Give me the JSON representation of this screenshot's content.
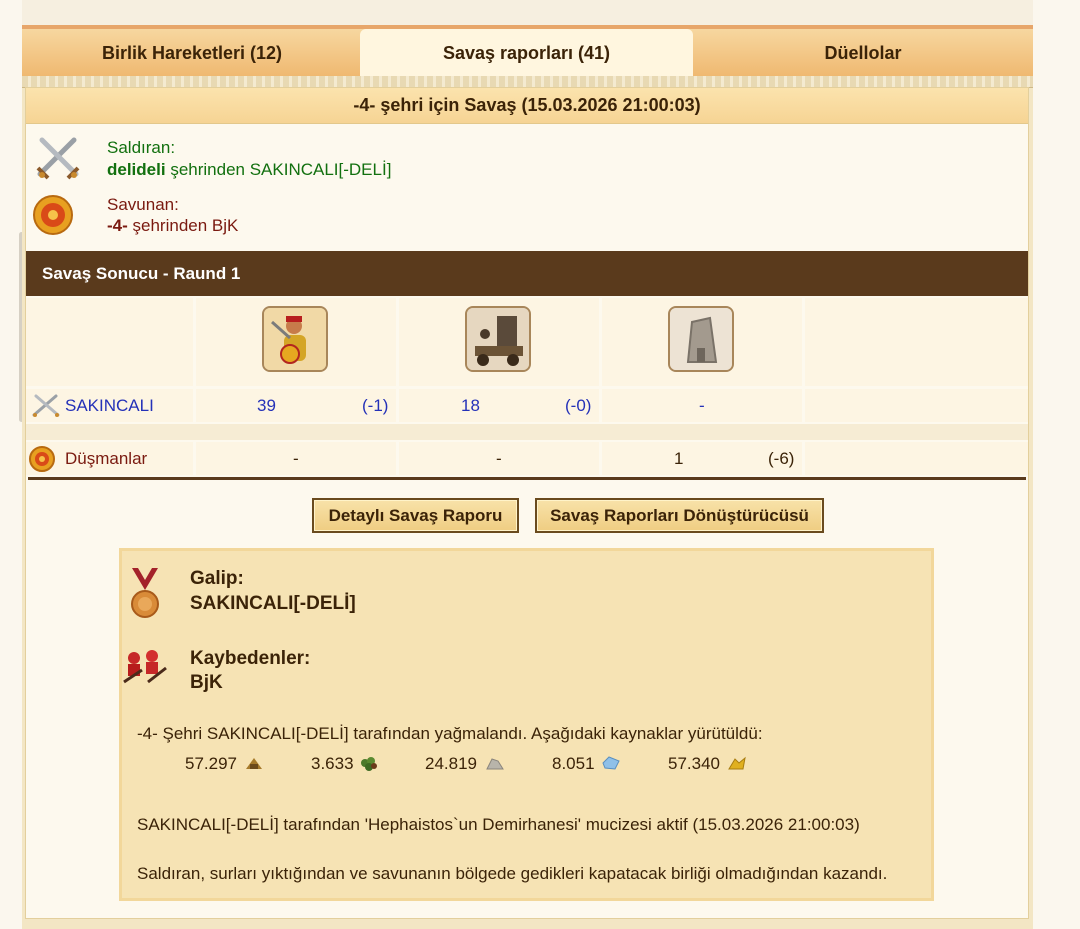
{
  "tabs": [
    {
      "label": "Birlik Hareketleri (12)"
    },
    {
      "label": "Savaş raporları (41)"
    },
    {
      "label": "Düellolar"
    }
  ],
  "report": {
    "title": "-4- şehri için Savaş (15.03.2026 21:00:03)"
  },
  "attacker": {
    "role": "Saldıran:",
    "city": "delideli",
    "suffix": "şehrinden SAKINCALI[-DELİ]"
  },
  "defender": {
    "role": "Savunan:",
    "city": "-4-",
    "suffix": "şehrinden BjK"
  },
  "battle": {
    "section_title": "Savaş Sonucu - Raund 1",
    "rows": [
      {
        "name": "SAKINCALI",
        "cells": [
          [
            "39",
            "(-1)"
          ],
          [
            "18",
            "(-0)"
          ],
          [
            "-",
            ""
          ]
        ]
      },
      {
        "name": "Düşmanlar",
        "cells": [
          [
            "-",
            ""
          ],
          [
            "-",
            ""
          ],
          [
            "1",
            "(-6)"
          ]
        ]
      }
    ]
  },
  "buttons": {
    "detail": "Detaylı Savaş Raporu",
    "converter": "Savaş Raporları Dönüştürücüsü"
  },
  "summary": {
    "winner_label": "Galip:",
    "winner": "SAKINCALI[-DELİ]",
    "losers_label": "Kaybedenler:",
    "losers": "BjK",
    "plunder_text": "-4- Şehri SAKINCALI[-DELİ] tarafından yağmalandı. Aşağıdaki kaynaklar yürütüldü:",
    "resources": [
      {
        "amount": "57.297",
        "icon": "wood-icon"
      },
      {
        "amount": "3.633",
        "icon": "grapes-icon"
      },
      {
        "amount": "24.819",
        "icon": "marble-icon"
      },
      {
        "amount": "8.051",
        "icon": "crystal-icon"
      },
      {
        "amount": "57.340",
        "icon": "sulphur-icon"
      }
    ],
    "wonder_text": "SAKINCALI[-DELİ] tarafından 'Hephaistos`un Demirhanesi' mucizesi aktif (15.03.2026 21:00:03)",
    "reason_text": "Saldıran, surları yıktığından ve savunanın bölgede gedikleri kapatacak birliği olmadığından kazandı."
  },
  "colors": {
    "attacker": "#12700f",
    "defender": "#7a1a10",
    "unit_value": "#2431b8",
    "section_bar": "#5a3a1c"
  }
}
